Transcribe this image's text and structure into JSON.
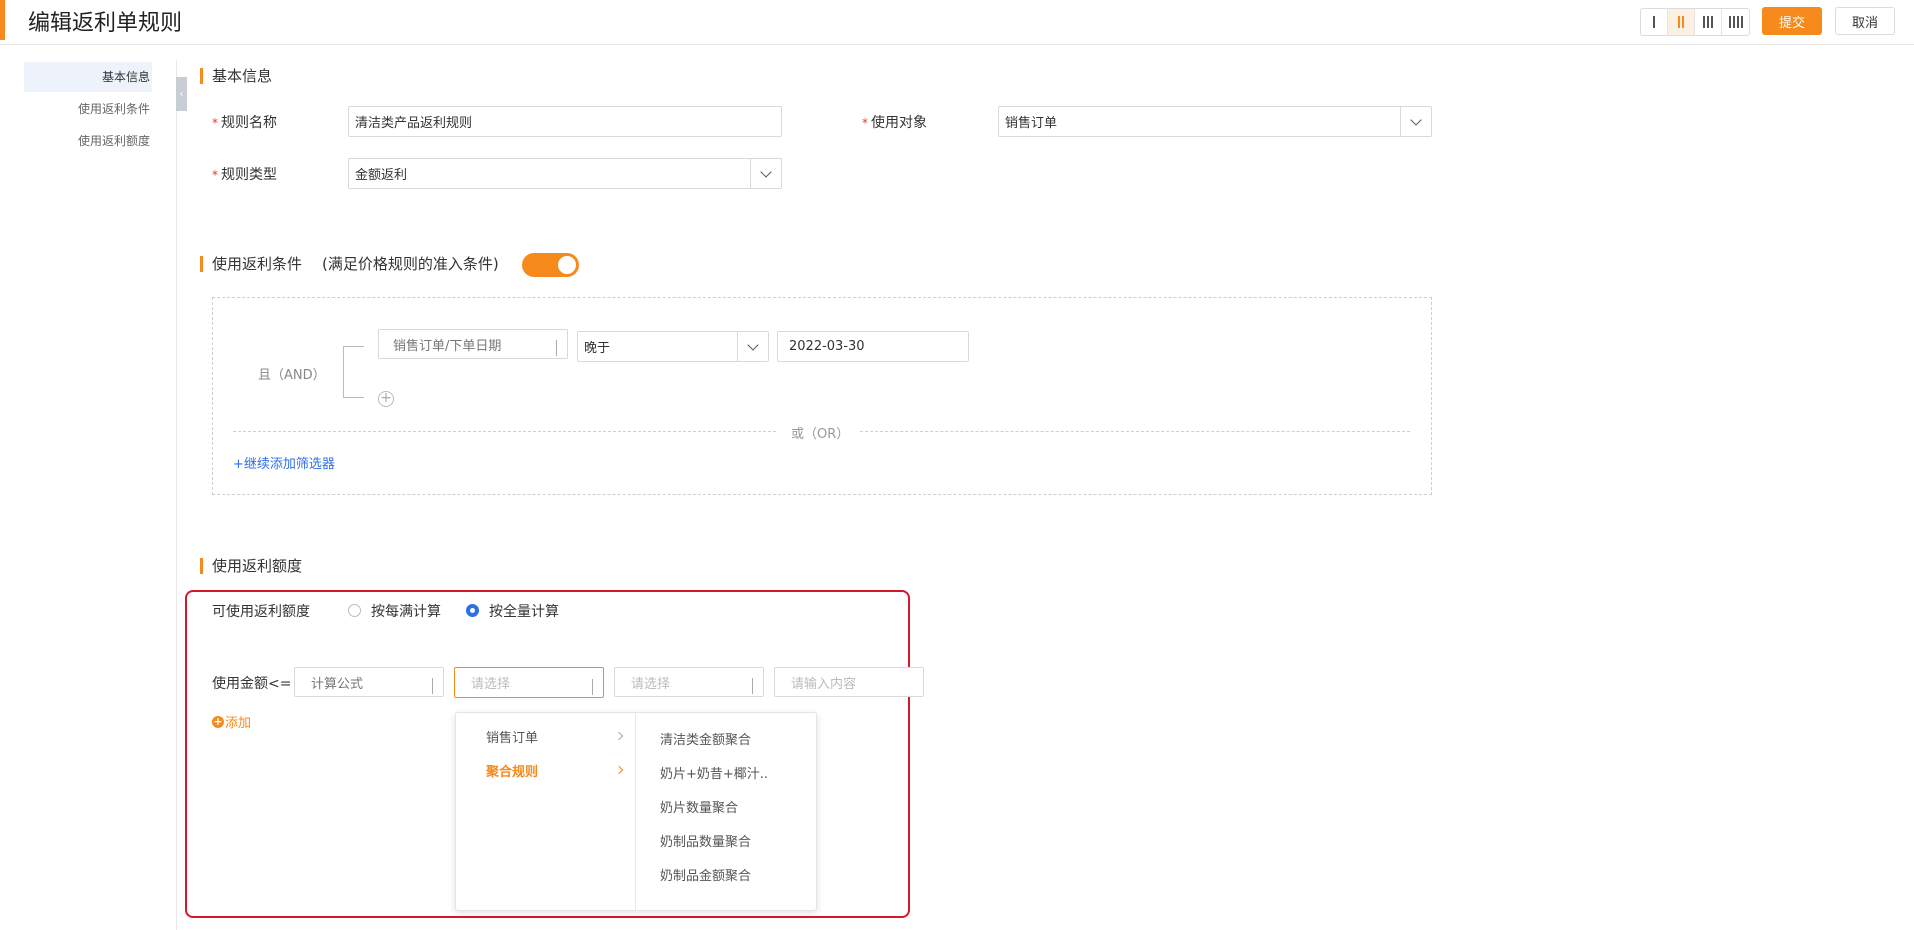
{
  "header": {
    "title": "编辑返利单规则",
    "submit_label": "提交",
    "cancel_label": "取消",
    "layout_options": [
      "1-column",
      "2-column",
      "3-column",
      "4-column"
    ],
    "layout_selected": "2-column",
    "accent_color": "#f68a1c"
  },
  "sidebar": {
    "items": [
      {
        "label": "基本信息",
        "active": true
      },
      {
        "label": "使用返利条件",
        "active": false
      },
      {
        "label": "使用返利额度",
        "active": false
      }
    ]
  },
  "basic": {
    "title": "基本信息",
    "rule_name_label": "规则名称",
    "rule_name_value": "清洁类产品返利规则",
    "target_label": "使用对象",
    "target_value": "销售订单",
    "rule_type_label": "规则类型",
    "rule_type_value": "金额返利",
    "required_mark": "*"
  },
  "conditions": {
    "title": "使用返利条件",
    "subtitle": "(满足价格规则的准入条件)",
    "enabled": true,
    "and_label": "且（AND）",
    "field_value": "销售订单/下单日期",
    "operator_value": "晚于",
    "date_value": "2022-03-30",
    "or_label": "或（OR）",
    "add_filter_label": "+继续添加筛选器"
  },
  "quota": {
    "title": "使用返利额度",
    "available_label": "可使用返利额度",
    "radio_options": [
      {
        "label": "按每满计算",
        "checked": false
      },
      {
        "label": "按全量计算",
        "checked": true
      }
    ],
    "amount_label": "使用金额<=",
    "formula_value": "计算公式",
    "select1_placeholder": "请选择",
    "select2_placeholder": "请选择",
    "input_placeholder": "请输入内容",
    "add_label": "添加"
  },
  "dropdown": {
    "left_items": [
      {
        "label": "销售订单",
        "active": false
      },
      {
        "label": "聚合规则",
        "active": true
      }
    ],
    "right_items": [
      "清洁类金额聚合",
      "奶片+奶昔+椰汁..",
      "奶片数量聚合",
      "奶制品数量聚合",
      "奶制品金额聚合"
    ]
  }
}
